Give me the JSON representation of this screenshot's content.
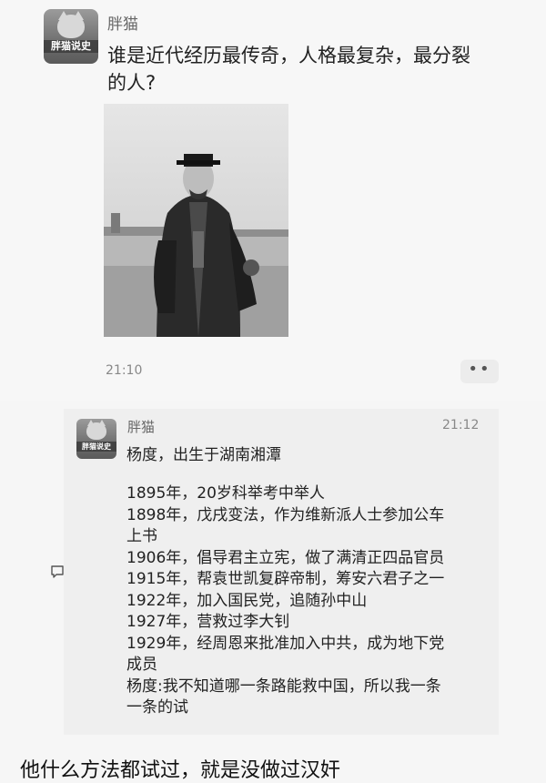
{
  "post": {
    "username": "胖猫",
    "avatar_tag": "胖猫说史",
    "question_line1": "谁是近代经历最传奇，人格最复杂，最分裂",
    "question_line2": "的人?",
    "time": "21:10",
    "more_label": "••"
  },
  "reply": {
    "username": "胖猫",
    "avatar_tag": "胖猫说史",
    "time": "21:12",
    "intro": "杨度，出生于湖南湘潭",
    "lines": [
      "1895年，20岁科举考中举人",
      "1898年，戊戌变法，作为维新派人士参加公车",
      "上书",
      "1906年，倡导君主立宪，做了满清正四品官员",
      "1915年，帮袁世凯复辟帝制，筹安六君子之一",
      "1922年，加入国民党，追随孙中山",
      "1927年，营救过李大钊",
      "1929年，经周恩来批准加入中共，成为地下党",
      "成员",
      "杨度:我不知道哪一条路能救中国，所以我一条",
      "一条的试"
    ]
  },
  "footer": {
    "text": "他什么方法都试过，就是没做过汉奸"
  },
  "icons": {
    "comment": "comment-icon",
    "more": "more-icon"
  }
}
